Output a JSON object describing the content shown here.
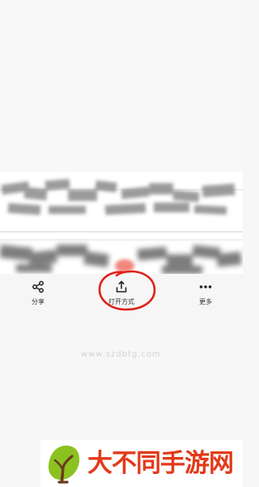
{
  "actions": {
    "share": {
      "label": "分享",
      "icon": "share-icon"
    },
    "open_with": {
      "label": "打开方式",
      "icon": "export-upload-icon"
    },
    "more": {
      "label": "更多",
      "icon": "more-dots-icon"
    }
  },
  "annotation": {
    "shape": "hand-drawn circle",
    "color": "#e0201a",
    "target": "open_with"
  },
  "watermark": {
    "text": "www.szdbtg.com"
  },
  "banner": {
    "brand_text": "大不同手游网",
    "brand_color": "#e23a1a",
    "logo": "leaf-logo-icon"
  }
}
